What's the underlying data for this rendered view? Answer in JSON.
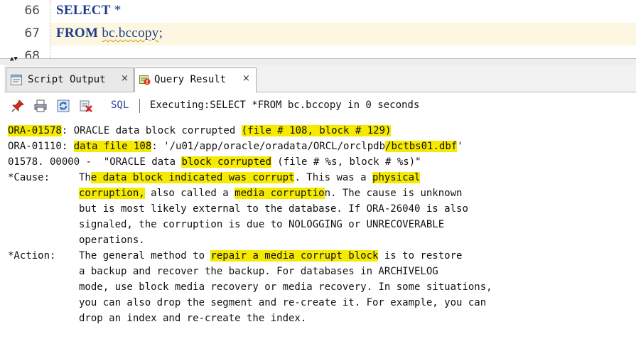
{
  "editor": {
    "lines": [
      {
        "number": "66",
        "keyword": "SELECT",
        "rest": " *"
      },
      {
        "number": "67",
        "keyword": "FROM",
        "rest_plain": " ",
        "rest_squiggle": "bc.bccopy",
        "rest_end": ";"
      },
      {
        "number": "68"
      }
    ]
  },
  "tabs": [
    {
      "label": "Script Output",
      "close": "×",
      "icon": "script-output-icon"
    },
    {
      "label": "Query Result",
      "close": "×",
      "icon": "query-error-icon"
    }
  ],
  "toolbar": {
    "icons": [
      "pin-icon",
      "print-icon",
      "refresh-icon",
      "export-error-icon"
    ],
    "sql_label": "SQL",
    "separator": "|",
    "status": "Executing:SELECT *FROM bc.bccopy in 0 seconds"
  },
  "output": {
    "l1_code": "ORA-01578",
    "l1_mid": ": ORACLE data block corrupted ",
    "l1_hl": "(file # 108, block # 129)",
    "l2_pre": "ORA-01110: ",
    "l2_hl1": "data file 108",
    "l2_mid": ": '/u01/app/oracle/oradata/ORCL/orclpdb",
    "l2_hl2": "/bctbs01.dbf",
    "l2_end": "'",
    "l3_pre": "01578. 00000 -  \"ORACLE data ",
    "l3_hl": "block corrupted",
    "l3_end": " (file # %s, block # %s)\"",
    "cause_label": "*Cause:",
    "c1_pre": "Th",
    "c1_hl": "e data block indicated was corrupt",
    "c1_mid": ". This was a ",
    "c1_hl2": "physical",
    "c2_hl": "corruption,",
    "c2_mid": " also called a ",
    "c2_hl2": "media corruptio",
    "c2_end": "n. The cause is unknown",
    "c3": "but is most likely external to the database. If ORA-26040 is also",
    "c4": "signaled, the corruption is due to NOLOGGING or UNRECOVERABLE",
    "c5": "operations.",
    "action_label": "*Action:",
    "a1_pre": "The general method to ",
    "a1_hl": "repair a media corrupt block",
    "a1_end": " is to restore",
    "a2": "a backup and recover the backup. For databases in ARCHIVELOG",
    "a3": "mode, use block media recovery or media recovery. In some situations,",
    "a4": "you can also drop the segment and re-create it. For example, you can",
    "a5": "drop an index and re-create the index."
  },
  "colors": {
    "highlight": "#f5ea00",
    "keyword": "#1e3a8c",
    "current_line": "#fdf7e1"
  }
}
